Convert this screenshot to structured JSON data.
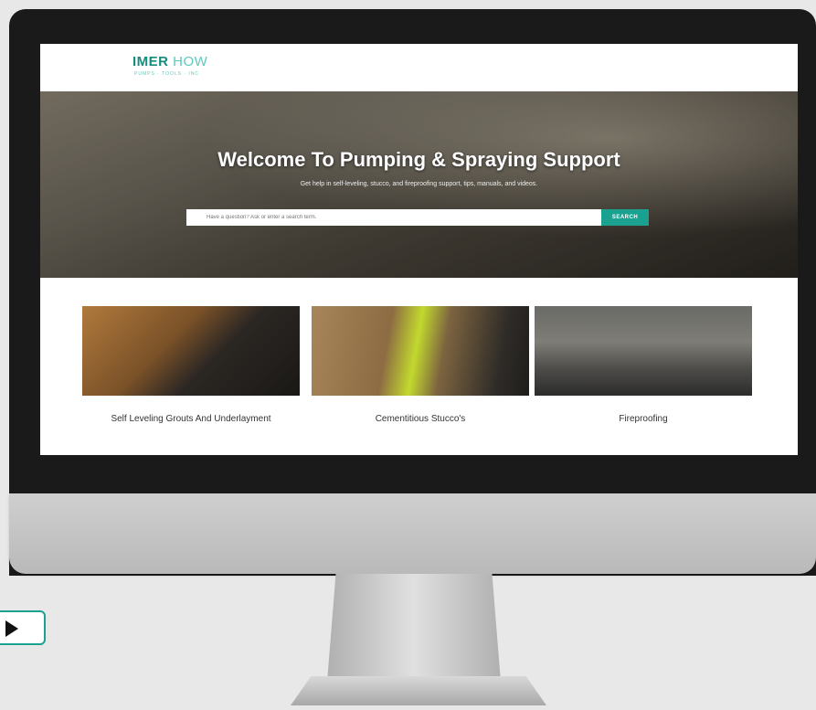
{
  "logo": {
    "part1": "IMER",
    "part2": "HOW",
    "tagline": "PUMPS · TOOLS · INC"
  },
  "hero": {
    "title": "Welcome To Pumping & Spraying Support",
    "subtitle": "Get help in self-leveling, stucco, and fireproofing support, tips, manuals, and videos.",
    "search_placeholder": "Have a question? Ask or enter a search term.",
    "search_button": "SEARCH"
  },
  "cards": [
    {
      "label": "Self Leveling Grouts And Underlayment"
    },
    {
      "label": "Cementitious Stucco's"
    },
    {
      "label": "Fireproofing"
    }
  ],
  "icons": {
    "play": "play-icon",
    "search": "search-icon"
  },
  "colors": {
    "accent": "#1aa190",
    "logo_dark": "#168c7c",
    "logo_light": "#5fc9bb"
  }
}
